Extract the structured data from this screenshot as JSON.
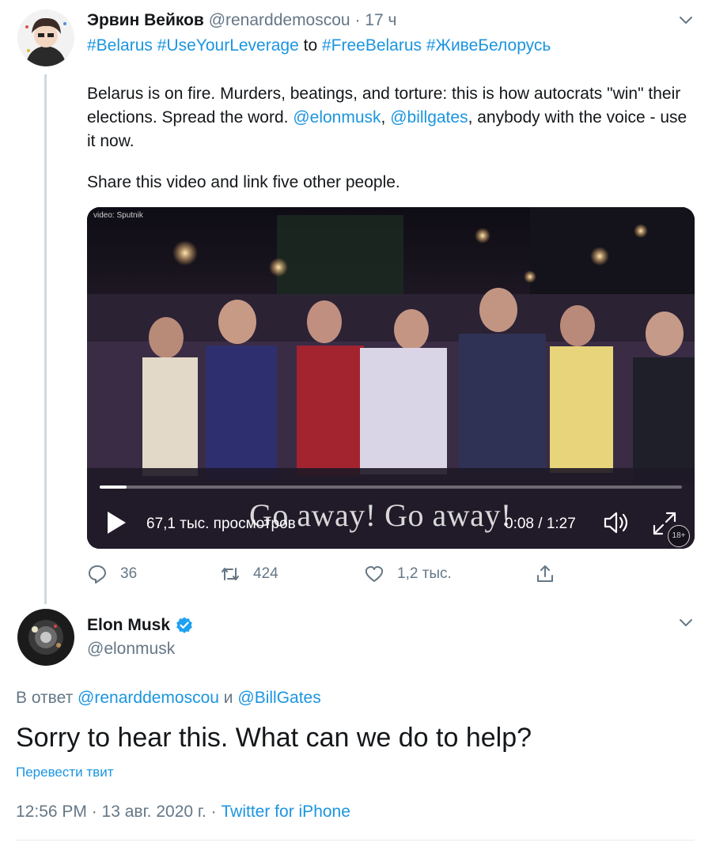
{
  "tweet": {
    "author_name": "Эрвин Вейков",
    "author_handle": "@renarddemoscou",
    "separator": " · ",
    "time_ago": "17 ч",
    "hashtags": {
      "h1": "#Belarus",
      "h2": "#UseYourLeverage",
      "to": "to",
      "h3": "#FreeBelarus",
      "h4": "#ЖивеБелорусь"
    },
    "body": {
      "part1": "Belarus is on fire. Murders, beatings, and torture: this is how autocrats \"win\" their elections. Spread the word. ",
      "mention1": "@elonmusk",
      "comma": ", ",
      "mention2": "@billgates",
      "part2": ", anybody with the voice - use it now."
    },
    "share_line": "Share this video and link five other people.",
    "video": {
      "credit": "video: Sputnik",
      "caption": "Go away! Go away!",
      "views": "67,1 тыс. просмотров",
      "timecode": "0:08 / 1:27",
      "progress": 0.046,
      "age_badge": "18+"
    },
    "actions": {
      "replies": "36",
      "retweets": "424",
      "likes": "1,2 тыс."
    }
  },
  "reply": {
    "author_name": "Elon Musk",
    "author_handle": "@elonmusk",
    "reply_prefix": "В ответ ",
    "reply_user1": "@renarddemoscou",
    "reply_and": " и ",
    "reply_user2": "@BillGates",
    "text": "Sorry to hear this. What can we do to help?",
    "translate_label": "Перевести твит",
    "timestamp": "12:56 PM · 13 авг. 2020 г. · ",
    "source": "Twitter for iPhone"
  },
  "colors": {
    "link": "#1b95e0",
    "muted": "#657786",
    "text": "#14171a",
    "verified": "#1da1f2"
  }
}
